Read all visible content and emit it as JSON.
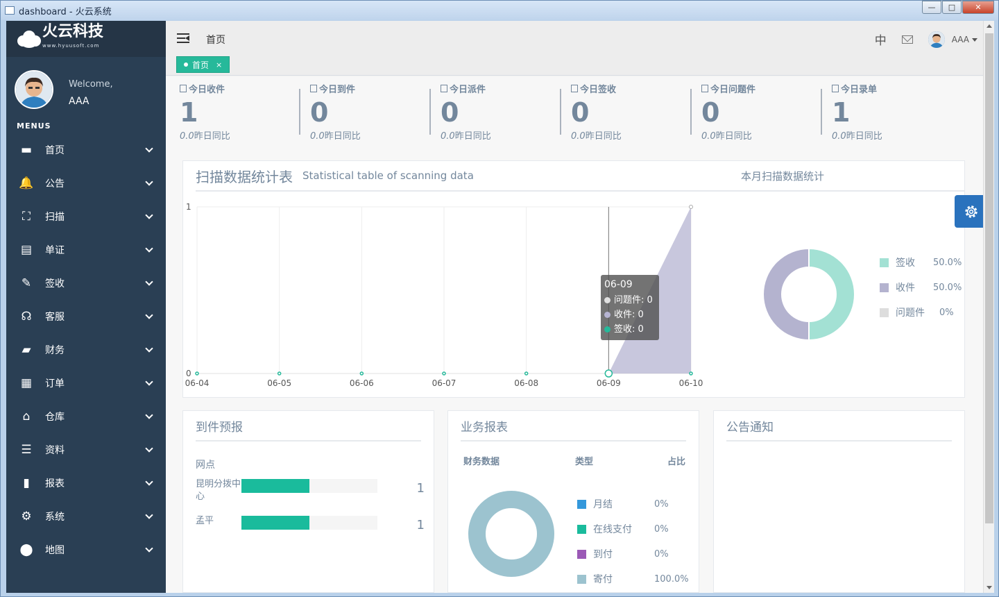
{
  "window": {
    "title": "dashboard - 火云系统",
    "min": "—",
    "max": "□",
    "close": "✕"
  },
  "sidebar": {
    "brand": "火云科技",
    "brand_url": "www.hyuusoft.com",
    "welcome": "Welcome,",
    "user": "AAA",
    "menus_title": "MENUS",
    "items": [
      {
        "label": "首页",
        "icon": "monitor-icon",
        "glyph": "▬"
      },
      {
        "label": "公告",
        "icon": "bell-icon",
        "glyph": "🔔"
      },
      {
        "label": "扫描",
        "icon": "scan-icon",
        "glyph": "⛶"
      },
      {
        "label": "单证",
        "icon": "document-icon",
        "glyph": "▤"
      },
      {
        "label": "签收",
        "icon": "pen-icon",
        "glyph": "✎"
      },
      {
        "label": "客服",
        "icon": "headset-icon",
        "glyph": "☊"
      },
      {
        "label": "财务",
        "icon": "wallet-icon",
        "glyph": "▰"
      },
      {
        "label": "订单",
        "icon": "clipboard-icon",
        "glyph": "▦"
      },
      {
        "label": "仓库",
        "icon": "home-icon",
        "glyph": "⌂"
      },
      {
        "label": "资料",
        "icon": "sliders-icon",
        "glyph": "☰"
      },
      {
        "label": "报表",
        "icon": "bar-chart-icon",
        "glyph": "▮"
      },
      {
        "label": "系统",
        "icon": "gear-icon",
        "glyph": "⚙"
      },
      {
        "label": "地图",
        "icon": "map-pin-icon",
        "glyph": "⬤"
      }
    ]
  },
  "topnav": {
    "breadcrumb": "首页",
    "lang": "中",
    "user": "AAA",
    "tab_label": "首页",
    "tab_close": "×"
  },
  "stats": [
    {
      "label": "今日收件",
      "value": "1",
      "sub_val": "0.0",
      "sub": "昨日同比"
    },
    {
      "label": "今日到件",
      "value": "0",
      "sub_val": "0.0",
      "sub": "昨日同比"
    },
    {
      "label": "今日派件",
      "value": "0",
      "sub_val": "0.0",
      "sub": "昨日同比"
    },
    {
      "label": "今日签收",
      "value": "0",
      "sub_val": "0.0",
      "sub": "昨日同比"
    },
    {
      "label": "今日问题件",
      "value": "0",
      "sub_val": "0.0",
      "sub": "昨日同比"
    },
    {
      "label": "今日录单",
      "value": "1",
      "sub_val": "0.0",
      "sub": "昨日同比"
    }
  ],
  "scan_panel": {
    "title": "扫描数据统计表",
    "subtitle": "Statistical table of scanning data",
    "tooltip": {
      "date": "06-09",
      "rows": [
        {
          "name": "问题件",
          "value": "0",
          "color": "#e0e0e0"
        },
        {
          "name": "收件",
          "value": "0",
          "color": "#b6b4d2"
        },
        {
          "name": "签收",
          "value": "0",
          "color": "#26b99a"
        }
      ]
    },
    "month_title": "本月扫描数据统计"
  },
  "chart_data": [
    {
      "type": "area",
      "x": [
        "06-04",
        "06-05",
        "06-06",
        "06-07",
        "06-08",
        "06-09",
        "06-10"
      ],
      "ylim": [
        0,
        1
      ],
      "yticks": [
        "0",
        "1"
      ],
      "series": [
        {
          "name": "问题件",
          "values": [
            0,
            0,
            0,
            0,
            0,
            0,
            0
          ],
          "color": "#e0e0e0"
        },
        {
          "name": "收件",
          "values": [
            0,
            0,
            0,
            0,
            0,
            0,
            1
          ],
          "color": "#b6b4d2"
        },
        {
          "name": "签收",
          "values": [
            0,
            0,
            0,
            0,
            0,
            0,
            0
          ],
          "color": "#26b99a"
        }
      ]
    },
    {
      "type": "pie",
      "labels": [
        "签收",
        "收件",
        "问题件"
      ],
      "values": [
        50,
        50,
        0
      ],
      "pct": [
        "50.0%",
        "50.0%",
        "0%"
      ],
      "colors": [
        "#a3e1d4",
        "#b4b3cf",
        "#dddddd"
      ]
    },
    {
      "type": "bar",
      "title": "到件预报",
      "column": "网点",
      "categories": [
        "昆明分拨中心",
        "孟平"
      ],
      "values": [
        1,
        1
      ],
      "fill": 0.5
    },
    {
      "type": "pie",
      "title": "业务报表",
      "headers": [
        "财务数据",
        "类型",
        "占比"
      ],
      "labels": [
        "月结",
        "在线支付",
        "到付",
        "寄付"
      ],
      "values": [
        0,
        0,
        0,
        100
      ],
      "pct": [
        "0%",
        "0%",
        "0%",
        "100.0%"
      ],
      "colors": [
        "#3498db",
        "#1abb9c",
        "#9b59b6",
        "#9cc3cf"
      ]
    }
  ],
  "notice_panel": {
    "title": "公告通知"
  }
}
